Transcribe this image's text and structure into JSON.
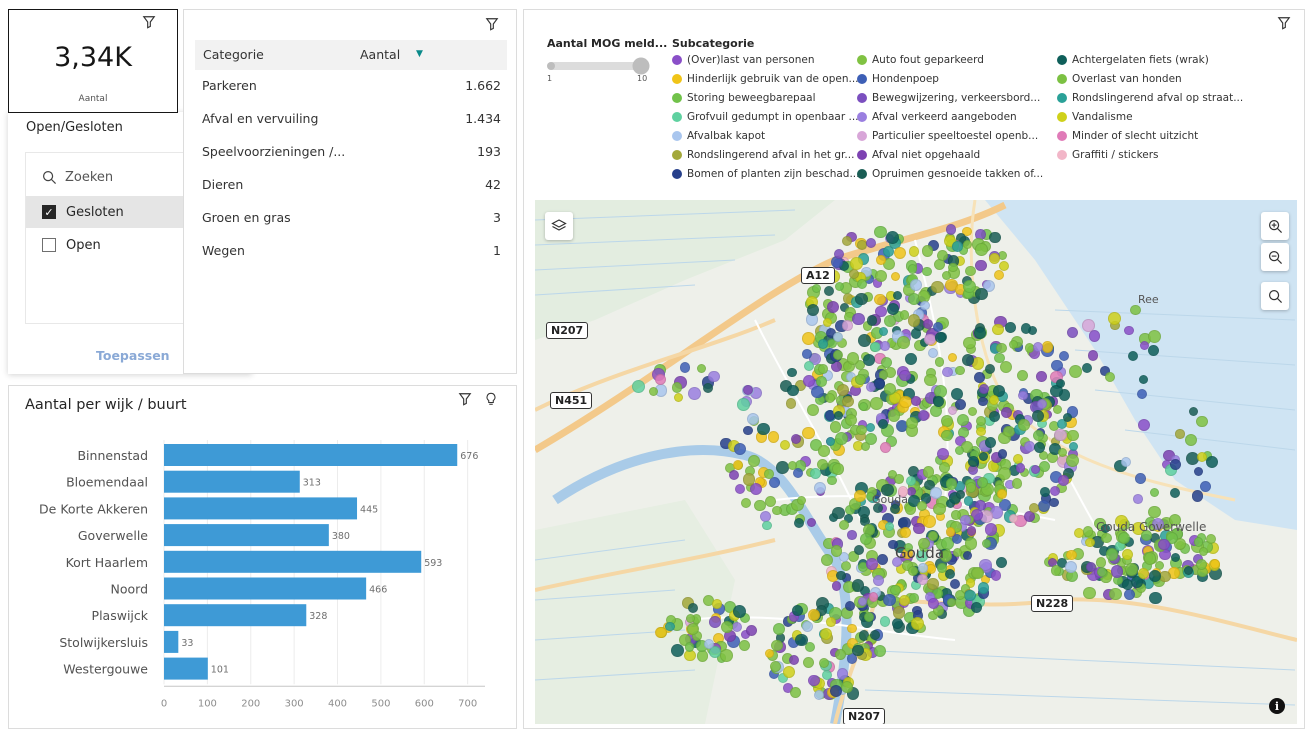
{
  "kpi": {
    "value": "3,34K",
    "label": "Aantal"
  },
  "filter": {
    "title": "Open/Gesloten",
    "search_placeholder": "Zoeken",
    "items": [
      {
        "label": "Gesloten",
        "checked": true
      },
      {
        "label": "Open",
        "checked": false
      }
    ],
    "apply_label": "Toepassen"
  },
  "categories": {
    "col_name": "Categorie",
    "col_value": "Aantal",
    "rows": [
      {
        "name": "Parkeren",
        "value": "1.662"
      },
      {
        "name": "Afval en vervuiling",
        "value": "1.434"
      },
      {
        "name": "Speelvoorzieningen /...",
        "value": "193"
      },
      {
        "name": "Dieren",
        "value": "42"
      },
      {
        "name": "Groen en gras",
        "value": "3"
      },
      {
        "name": "Wegen",
        "value": "1"
      }
    ]
  },
  "chart_data": {
    "type": "bar",
    "orientation": "horizontal",
    "title": "Aantal per wijk / buurt",
    "categories": [
      "Binnenstad",
      "Bloemendaal",
      "De Korte Akkeren",
      "Goverwelle",
      "Kort Haarlem",
      "Noord",
      "Plaswijck",
      "Stolwijkersluis",
      "Westergouwe"
    ],
    "values": [
      676,
      313,
      445,
      380,
      593,
      466,
      328,
      33,
      101
    ],
    "value_labels": [
      "676",
      "313",
      "445",
      "380",
      "593",
      "466",
      "328",
      "33",
      "101"
    ],
    "xlim": [
      0,
      740
    ],
    "xticks": [
      0,
      100,
      200,
      300,
      400,
      500,
      600,
      700
    ],
    "xtick_labels": [
      "0",
      "100",
      "200",
      "300",
      "400",
      "500",
      "600",
      "700"
    ],
    "grid": true,
    "color": "#3e9ad6"
  },
  "map_legend": {
    "size_title": "Aantal MOG meld...",
    "size_min": "1",
    "size_max": "10",
    "subcat_title": "Subcategorie",
    "items": [
      {
        "label": "(Over)last van personen",
        "color": "#8a4fc8"
      },
      {
        "label": "Auto fout geparkeerd",
        "color": "#80c242"
      },
      {
        "label": "Achtergelaten fiets (wrak)",
        "color": "#0f5f5a"
      },
      {
        "label": "Hinderlijk gebruik van de open...",
        "color": "#f0c418"
      },
      {
        "label": "Hondenpoep",
        "color": "#3d5fb6"
      },
      {
        "label": "Overlast van honden",
        "color": "#7cc143"
      },
      {
        "label": "Storing beweegbarepaal",
        "color": "#71c24a"
      },
      {
        "label": "Bewegwijzering, verkeersbord...",
        "color": "#7b4fbf"
      },
      {
        "label": "Rondslingerend afval op straat...",
        "color": "#2aa198"
      },
      {
        "label": "Grofvuil gedumpt in openbaar ...",
        "color": "#5fd1a0"
      },
      {
        "label": "Afval verkeerd aangeboden",
        "color": "#9a7fe0"
      },
      {
        "label": "Vandalisme",
        "color": "#cfd11a"
      },
      {
        "label": "Afvalbak kapot",
        "color": "#a9c6ee"
      },
      {
        "label": "Particulier speeltoestel openb...",
        "color": "#d8a6d8"
      },
      {
        "label": "Minder of slecht uitzicht",
        "color": "#e07bb8"
      },
      {
        "label": "Rondslingerend afval in het gr...",
        "color": "#a3a83a"
      },
      {
        "label": "Afval niet opgehaald",
        "color": "#7d42b2"
      },
      {
        "label": "Graffiti / stickers",
        "color": "#f2b6c8"
      },
      {
        "label": "Bomen of planten zijn beschad...",
        "color": "#27408b"
      },
      {
        "label": "Opruimen gesnoeide takken of...",
        "color": "#1a5e55"
      }
    ]
  },
  "map": {
    "road_labels": [
      "A12",
      "N207",
      "N451",
      "N228",
      "N207"
    ],
    "place_labels": [
      "Gouda",
      "Gouda",
      "Gouda Goverwelle",
      "Ree"
    ],
    "icons": [
      "layers-icon",
      "zoom-in-icon",
      "zoom-out-icon",
      "search-icon",
      "info-icon",
      "filter-icon",
      "lightbulb-icon"
    ]
  }
}
